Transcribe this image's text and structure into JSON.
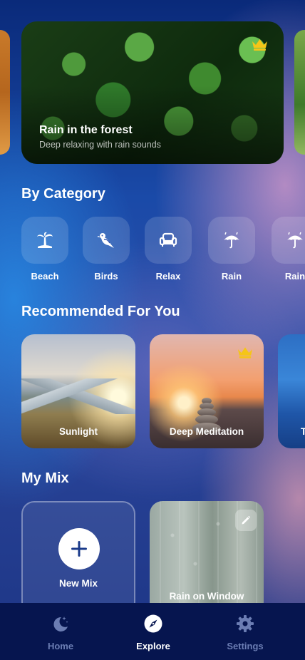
{
  "hero": {
    "title": "Rain in the forest",
    "subtitle": "Deep relaxing with rain sounds",
    "premium_icon": "crown-icon"
  },
  "categories_section": {
    "title": "By Category",
    "items": [
      {
        "label": "Beach",
        "icon": "palm-tree-icon"
      },
      {
        "label": "Birds",
        "icon": "bird-icon"
      },
      {
        "label": "Relax",
        "icon": "armchair-icon"
      },
      {
        "label": "Rain",
        "icon": "umbrella-rain-icon"
      },
      {
        "label": "Rain",
        "icon": "umbrella-rain-icon"
      }
    ]
  },
  "recommended_section": {
    "title": "Recommended For You",
    "items": [
      {
        "label": "Sunlight",
        "premium": false
      },
      {
        "label": "Deep Meditation",
        "premium": true
      },
      {
        "label": "T",
        "premium": false
      }
    ]
  },
  "mix_section": {
    "title": "My Mix",
    "new_mix_label": "New Mix",
    "items": [
      {
        "label": "Rain on Window",
        "icon": "pencil-icon"
      }
    ]
  },
  "nav": {
    "items": [
      {
        "label": "Home",
        "icon": "moon-stars-icon",
        "active": false
      },
      {
        "label": "Explore",
        "icon": "compass-icon",
        "active": true
      },
      {
        "label": "Settings",
        "icon": "gear-icon",
        "active": false
      }
    ]
  },
  "colors": {
    "premium_gold": "#f5c518",
    "nav_background": "#06154f",
    "nav_inactive": "#6b7db3"
  }
}
